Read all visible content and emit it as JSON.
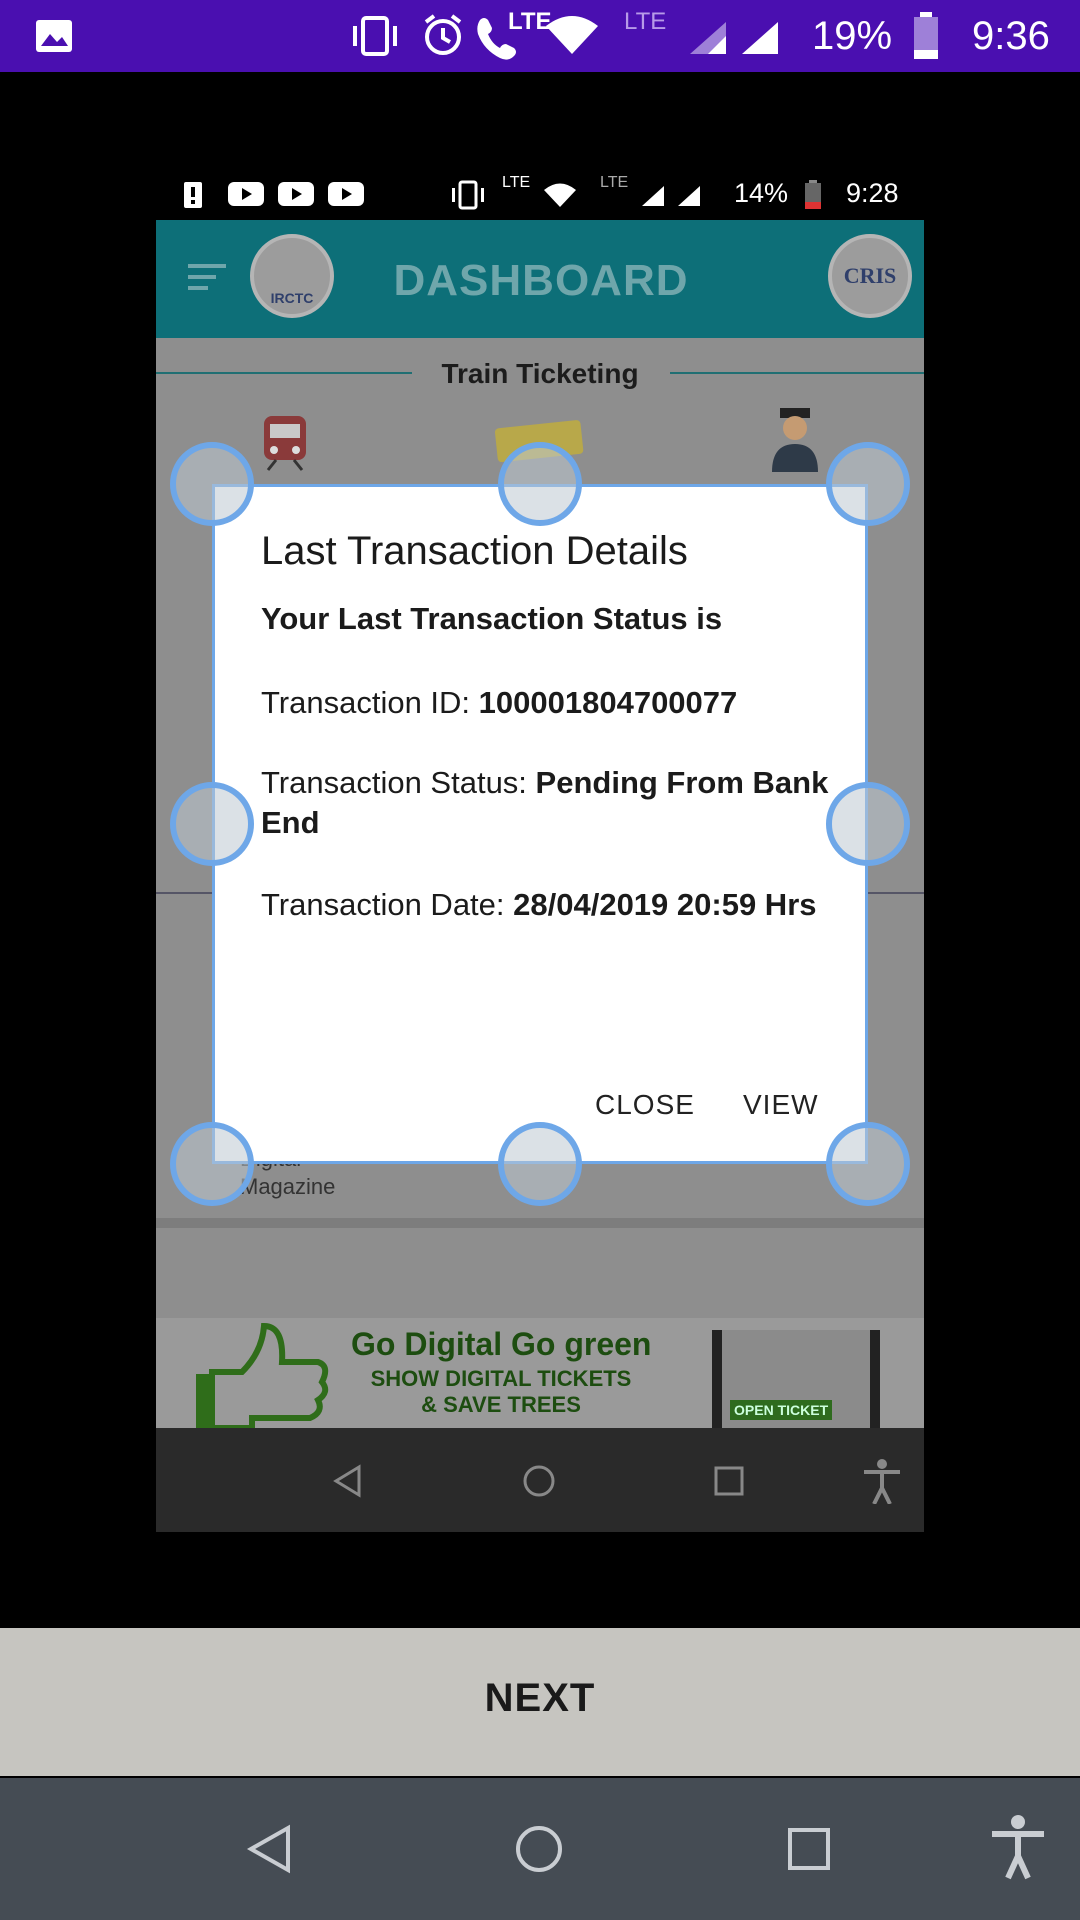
{
  "outer_status": {
    "network": "LTE",
    "network2": "LTE",
    "battery": "19%",
    "time": "9:36"
  },
  "inner_status": {
    "network": "LTE",
    "network2": "LTE",
    "battery": "14%",
    "time": "9:28"
  },
  "app_bar": {
    "title": "DASHBOARD",
    "left_logo": "IRCTC",
    "right_logo": "CRIS"
  },
  "background": {
    "section_title": "Train Ticketing",
    "tile_label_line1": "Digital",
    "tile_label_line2": "Magazine",
    "banner_title": "Go Digital Go green",
    "banner_line1": "SHOW DIGITAL TICKETS",
    "banner_line2": "& SAVE TREES",
    "banner_badge": "OPEN TICKET"
  },
  "dialog": {
    "title": "Last Transaction Details",
    "subtitle": "Your Last Transaction Status is",
    "rows": [
      {
        "label": "Transaction ID: ",
        "value": "100001804700077"
      },
      {
        "label": "Transaction Status: ",
        "value": "Pending From Bank End"
      },
      {
        "label": "Transaction Date: ",
        "value": "28/04/2019 20:59 Hrs"
      }
    ],
    "close_label": "CLOSE",
    "view_label": "VIEW"
  },
  "next_label": "NEXT",
  "colors": {
    "status_bar": "#4a0fb0",
    "app_bar": "#0d6f78",
    "handle": "#6ea7e8",
    "nav_bar": "#454c54"
  },
  "icons": [
    "image-icon",
    "vibrate-icon",
    "alarm-icon",
    "wifi-calling-icon",
    "wifi-icon",
    "signal-icon",
    "battery-icon",
    "menu-icon",
    "back-icon",
    "home-icon",
    "recents-icon",
    "accessibility-icon"
  ]
}
